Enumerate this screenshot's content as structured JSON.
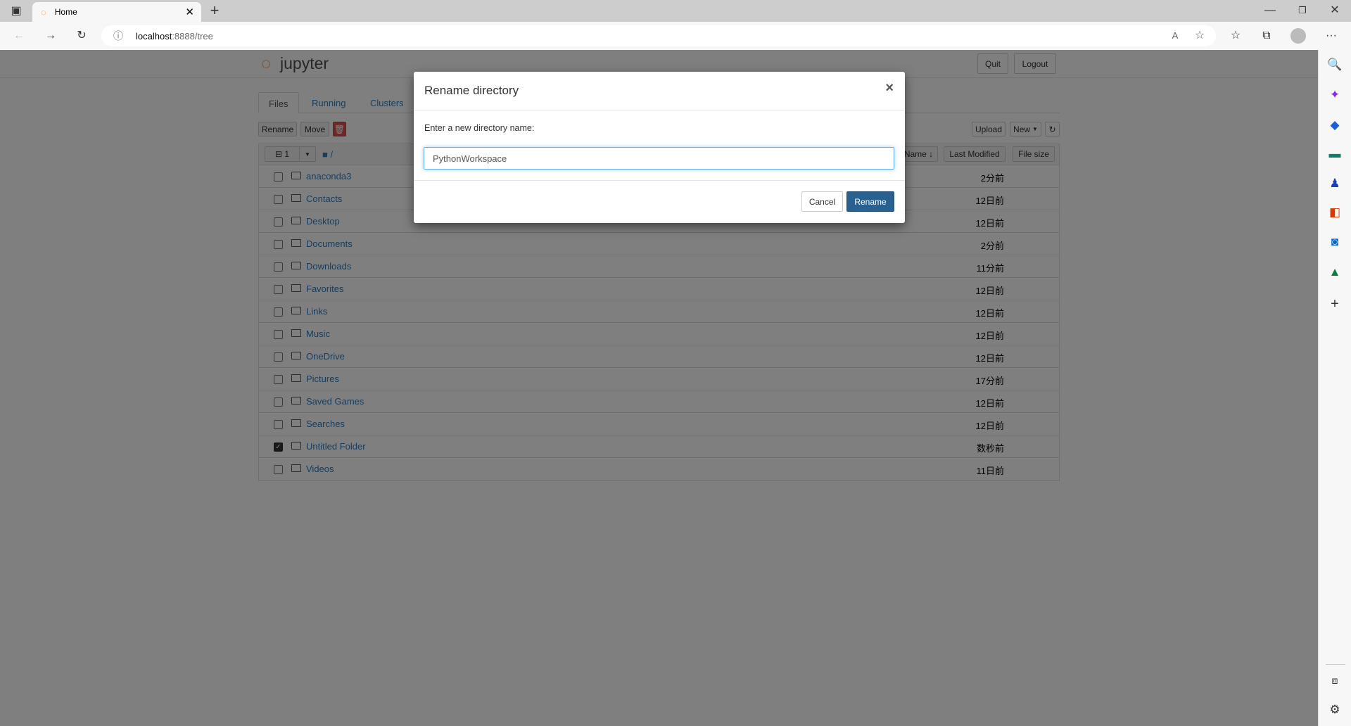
{
  "browser": {
    "tab_title": "Home",
    "url_host": "localhost",
    "url_rest": ":8888/tree",
    "icons": [
      "sidebar-toggle-icon",
      "jupyter-favicon",
      "close-icon",
      "new-tab-icon",
      "back-icon",
      "forward-icon",
      "reload-icon",
      "info-icon",
      "read-aloud-icon",
      "add-favorite-icon",
      "favorites-icon",
      "collections-icon",
      "profile-icon",
      "more-icon",
      "minimize-icon",
      "restore-icon",
      "window-close-icon"
    ],
    "sidebar_icons": [
      "search-icon",
      "copilot-icon",
      "shopping-icon",
      "tools-icon",
      "games-icon",
      "office-icon",
      "outlook-icon",
      "tree-icon",
      "add-icon",
      "split-screen-icon",
      "settings-icon"
    ]
  },
  "jupyter": {
    "logo_text": "jupyter",
    "quit": "Quit",
    "logout": "Logout",
    "tabs": [
      "Files",
      "Running",
      "Clusters"
    ],
    "toolbar": {
      "rename": "Rename",
      "move": "Move",
      "upload": "Upload",
      "new": "New"
    },
    "list_header": {
      "selected_count": "1",
      "path": "/",
      "name_sort": "Name",
      "last_modified": "Last Modified",
      "file_size": "File size"
    },
    "items": [
      {
        "name": "anaconda3",
        "modified": "2分前",
        "checked": false
      },
      {
        "name": "Contacts",
        "modified": "12日前",
        "checked": false
      },
      {
        "name": "Desktop",
        "modified": "12日前",
        "checked": false
      },
      {
        "name": "Documents",
        "modified": "2分前",
        "checked": false
      },
      {
        "name": "Downloads",
        "modified": "11分前",
        "checked": false
      },
      {
        "name": "Favorites",
        "modified": "12日前",
        "checked": false
      },
      {
        "name": "Links",
        "modified": "12日前",
        "checked": false
      },
      {
        "name": "Music",
        "modified": "12日前",
        "checked": false
      },
      {
        "name": "OneDrive",
        "modified": "12日前",
        "checked": false
      },
      {
        "name": "Pictures",
        "modified": "17分前",
        "checked": false
      },
      {
        "name": "Saved Games",
        "modified": "12日前",
        "checked": false
      },
      {
        "name": "Searches",
        "modified": "12日前",
        "checked": false
      },
      {
        "name": "Untitled Folder",
        "modified": "数秒前",
        "checked": true
      },
      {
        "name": "Videos",
        "modified": "11日前",
        "checked": false
      }
    ]
  },
  "modal": {
    "title": "Rename directory",
    "label": "Enter a new directory name:",
    "input_value": "PythonWorkspace",
    "cancel": "Cancel",
    "rename": "Rename",
    "primary_color": "#286090"
  }
}
